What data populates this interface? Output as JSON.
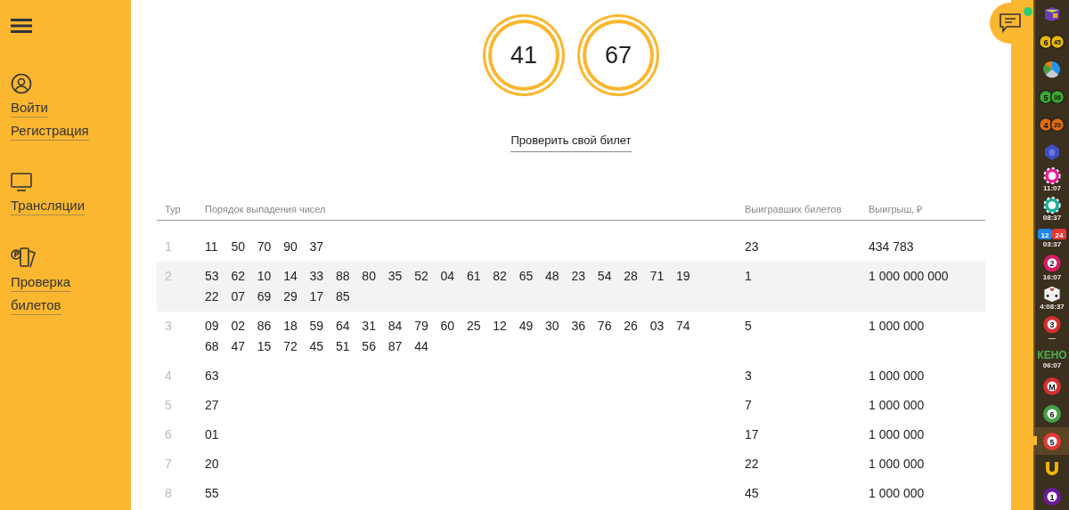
{
  "sidebar": {
    "items": [
      {
        "kind": "user",
        "labels": [
          "Войти",
          "Регистрация"
        ]
      },
      {
        "kind": "tv",
        "labels": [
          "Трансляции"
        ]
      },
      {
        "kind": "tickets",
        "labels": [
          "Проверка",
          "билетов"
        ]
      }
    ]
  },
  "balls": [
    "41",
    "67"
  ],
  "check_link": "Проверить свой билет",
  "table": {
    "columns": [
      "Тур",
      "Порядок выпадения чисел",
      "Выигравших билетов",
      "Выигрыш, ₽"
    ],
    "rows": [
      {
        "tour": "1",
        "numbers": [
          "11",
          "50",
          "70",
          "90",
          "37"
        ],
        "winners": "23",
        "prize": "434 783",
        "highlighted": false
      },
      {
        "tour": "2",
        "numbers": [
          "53",
          "62",
          "10",
          "14",
          "33",
          "88",
          "80",
          "35",
          "52",
          "04",
          "61",
          "82",
          "65",
          "48",
          "23",
          "54",
          "28",
          "71",
          "19",
          "22",
          "07",
          "69",
          "29",
          "17",
          "85"
        ],
        "winners": "1",
        "prize": "1 000 000 000",
        "highlighted": true
      },
      {
        "tour": "3",
        "numbers": [
          "09",
          "02",
          "86",
          "18",
          "59",
          "64",
          "31",
          "84",
          "79",
          "60",
          "25",
          "12",
          "49",
          "30",
          "36",
          "76",
          "26",
          "03",
          "74",
          "68",
          "47",
          "15",
          "72",
          "45",
          "51",
          "56",
          "87",
          "44"
        ],
        "winners": "5",
        "prize": "1 000 000",
        "highlighted": false
      },
      {
        "tour": "4",
        "numbers": [
          "63"
        ],
        "winners": "3",
        "prize": "1 000 000",
        "highlighted": false
      },
      {
        "tour": "5",
        "numbers": [
          "27"
        ],
        "winners": "7",
        "prize": "1 000 000",
        "highlighted": false
      },
      {
        "tour": "6",
        "numbers": [
          "01"
        ],
        "winners": "17",
        "prize": "1 000 000",
        "highlighted": false
      },
      {
        "tour": "7",
        "numbers": [
          "20"
        ],
        "winners": "22",
        "prize": "1 000 000",
        "highlighted": false
      },
      {
        "tour": "8",
        "numbers": [
          "55"
        ],
        "winners": "45",
        "prize": "1 000 000",
        "highlighted": false
      }
    ]
  },
  "chat": {
    "unread": true
  },
  "games": [
    {
      "kind": "cube",
      "selected": false
    },
    {
      "kind": "pair",
      "texts": [
        "6",
        "45"
      ],
      "color": "#e8b800",
      "selected": false
    },
    {
      "kind": "x",
      "selected": false
    },
    {
      "kind": "pair",
      "texts": [
        "5",
        "36"
      ],
      "color": "#3aa82a",
      "selected": false
    },
    {
      "kind": "pair",
      "texts": [
        "4",
        "20"
      ],
      "color": "#e06a10",
      "selected": false
    },
    {
      "kind": "dodeca",
      "selected": false
    },
    {
      "kind": "chip",
      "color": "#e0249a",
      "time": "11:07",
      "selected": false
    },
    {
      "kind": "chip",
      "color": "#1bb39a",
      "time": "08:37",
      "selected": false
    },
    {
      "kind": "duo",
      "texts": [
        "12",
        "24"
      ],
      "time": "03:37",
      "selected": false
    },
    {
      "kind": "ball",
      "texts": [
        "2"
      ],
      "color": "#d81b60",
      "time": "16:07",
      "selected": false
    },
    {
      "kind": "dice",
      "time": "4:08:37",
      "selected": false
    },
    {
      "kind": "ball",
      "texts": [
        "3"
      ],
      "color": "#d32f2f",
      "time": "—",
      "selected": false
    },
    {
      "kind": "word",
      "texts": [
        "КЕНО"
      ],
      "color": "#4caf50",
      "time": "06:07",
      "selected": false
    },
    {
      "kind": "ball",
      "texts": [
        "М"
      ],
      "color": "#d32f2f",
      "selected": false
    },
    {
      "kind": "ball",
      "texts": [
        "6"
      ],
      "color": "#43a047",
      "selected": false
    },
    {
      "kind": "ball",
      "texts": [
        "5"
      ],
      "color": "#e53935",
      "selected": true
    },
    {
      "kind": "horseshoe",
      "selected": false
    },
    {
      "kind": "ball",
      "texts": [
        "1"
      ],
      "color": "#6a1b9a",
      "selected": false
    }
  ]
}
